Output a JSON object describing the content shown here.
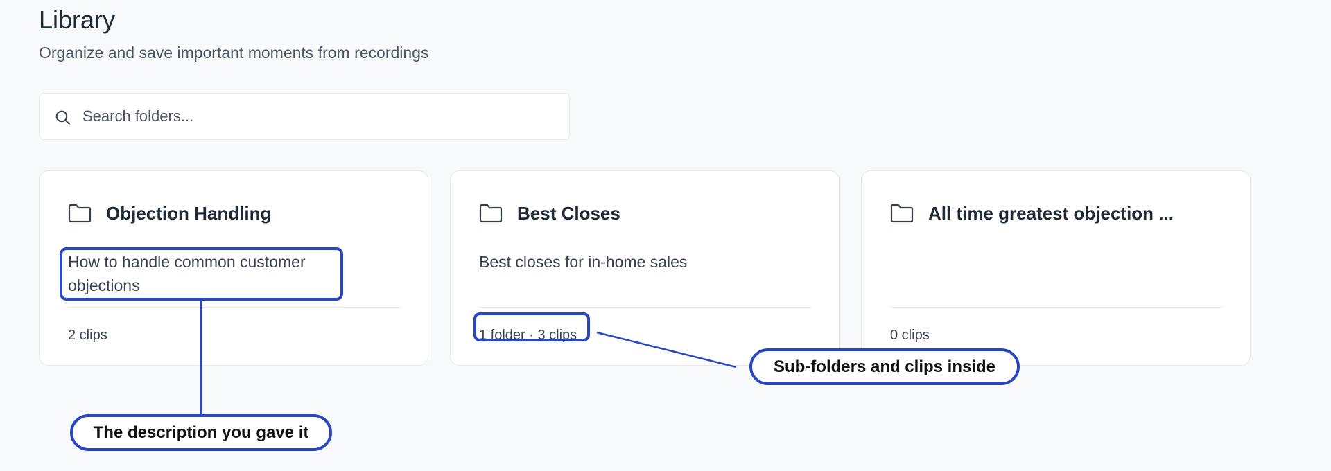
{
  "header": {
    "title": "Library",
    "subtitle": "Organize and save important moments from recordings"
  },
  "search": {
    "placeholder": "Search folders...",
    "value": "",
    "icon": "search-icon"
  },
  "folders": [
    {
      "icon": "folder-icon",
      "title": "Objection Handling",
      "description": "How to handle common customer objections",
      "meta": "2 clips"
    },
    {
      "icon": "folder-icon",
      "title": "Best Closes",
      "description": "Best closes for in-home sales",
      "meta": "1 folder · 3 clips"
    },
    {
      "icon": "folder-icon",
      "title": "All time greatest objection ...",
      "description": "",
      "meta": "0 clips"
    }
  ],
  "annotations": {
    "description_callout": "The description you gave it",
    "contents_callout": "Sub-folders and clips inside",
    "accent_color": "#2947c4"
  }
}
